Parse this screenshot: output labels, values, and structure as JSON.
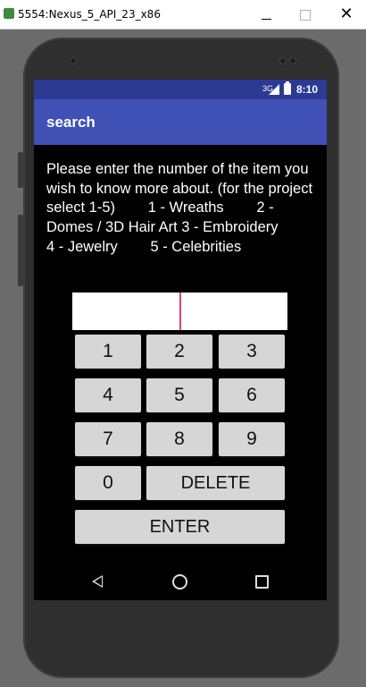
{
  "window": {
    "title": "5554:Nexus_5_API_23_x86",
    "close_glyph": "✕"
  },
  "status_bar": {
    "network_type": "3G",
    "time": "8:10"
  },
  "action_bar": {
    "title": "search",
    "color": "#3f51b5"
  },
  "prompt": {
    "text": "Please enter the number of the item you wish to know more about. (for the project select 1-5)        1 - Wreaths        2 - Domes / 3D Hair Art 3 - Embroidery        4 - Jewelry        5 - Celebrities"
  },
  "input": {
    "value": "",
    "cursor_color": "#e0407a"
  },
  "keypad": {
    "keys": [
      "1",
      "2",
      "3",
      "4",
      "5",
      "6",
      "7",
      "8",
      "9",
      "0"
    ],
    "delete_label": "DELETE",
    "enter_label": "ENTER"
  },
  "nav_bar": {
    "icons": [
      "back-icon",
      "home-icon",
      "recents-icon"
    ]
  }
}
